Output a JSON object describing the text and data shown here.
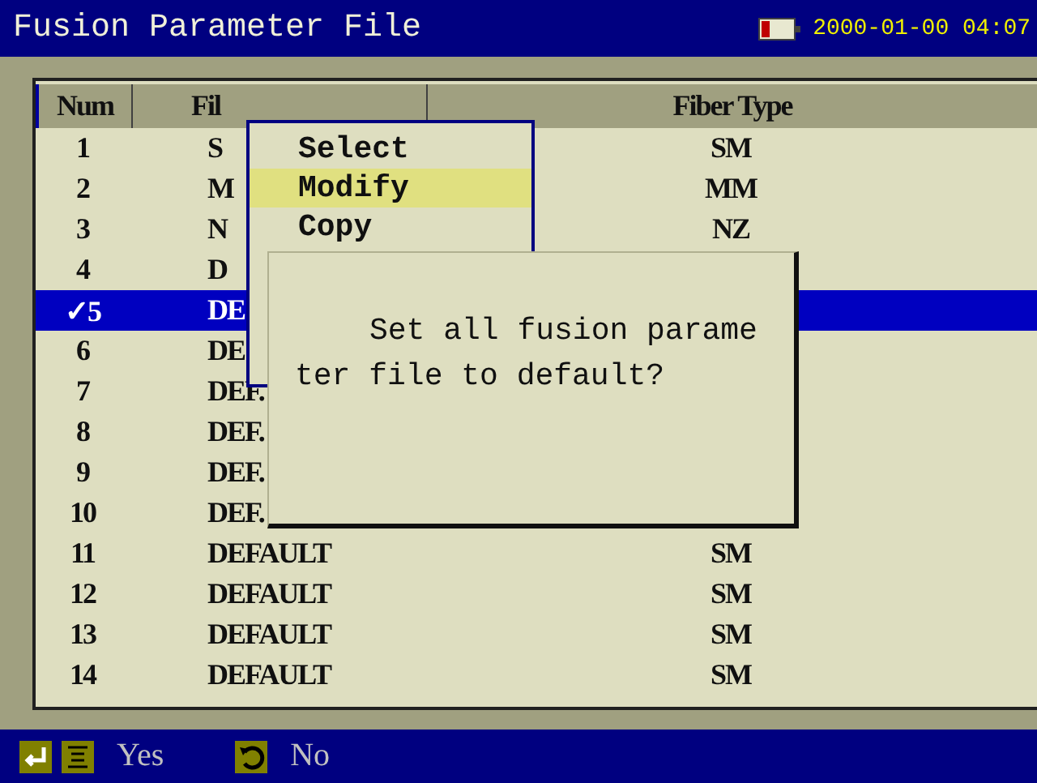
{
  "title_bar": {
    "title": "Fusion Parameter File",
    "datetime": "2000-01-00 04:07"
  },
  "table": {
    "columns": [
      "Num",
      "Fil",
      "Fiber Type"
    ],
    "rows": [
      {
        "num": "1",
        "name": "S",
        "fiber": "SM",
        "selected": false
      },
      {
        "num": "2",
        "name": "M",
        "fiber": "MM",
        "selected": false
      },
      {
        "num": "3",
        "name": "N",
        "fiber": "NZ",
        "selected": false
      },
      {
        "num": "4",
        "name": "D",
        "selected": false
      },
      {
        "num": "✓5",
        "name": "DE",
        "selected": true
      },
      {
        "num": "6",
        "name": "DE",
        "selected": false
      },
      {
        "num": "7",
        "name": "DEF.",
        "selected": false
      },
      {
        "num": "8",
        "name": "DEF.",
        "selected": false
      },
      {
        "num": "9",
        "name": "DEF.",
        "selected": false
      },
      {
        "num": "10",
        "name": "DEF.",
        "selected": false
      },
      {
        "num": "11",
        "name": "DEFAULT",
        "fiber": "SM",
        "selected": false
      },
      {
        "num": "12",
        "name": "DEFAULT",
        "fiber": "SM",
        "selected": false
      },
      {
        "num": "13",
        "name": "DEFAULT",
        "fiber": "SM",
        "selected": false
      },
      {
        "num": "14",
        "name": "DEFAULT",
        "fiber": "SM",
        "selected": false
      }
    ]
  },
  "context_menu": {
    "items": [
      {
        "label": "Select",
        "selected": false
      },
      {
        "label": "Modify",
        "selected": true
      },
      {
        "label": "Copy",
        "selected": false
      }
    ]
  },
  "dialog": {
    "lines": [
      "Set all fusion parame",
      "ter file to default?"
    ]
  },
  "bottom_bar": {
    "actions": [
      {
        "kind": "yes",
        "label": "Yes"
      },
      {
        "kind": "no",
        "label": "No"
      }
    ]
  }
}
